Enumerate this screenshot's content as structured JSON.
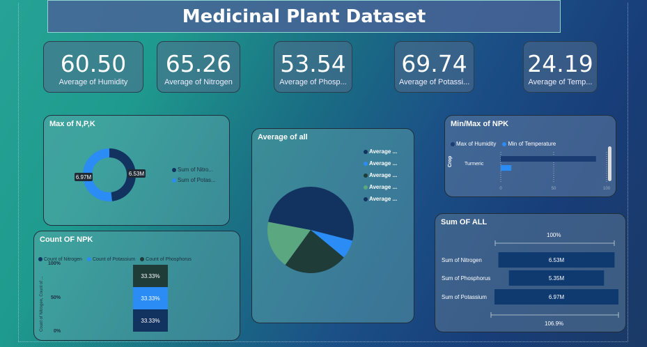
{
  "title": "Medicinal Plant Dataset",
  "kpis": [
    {
      "value": "60.50",
      "label": "Average of Humidity"
    },
    {
      "value": "65.26",
      "label": "Average of Nitrogen"
    },
    {
      "value": "53.54",
      "label": "Average of Phosp..."
    },
    {
      "value": "69.74",
      "label": "Average of Potassi..."
    },
    {
      "value": "24.19",
      "label": "Average of Temp..."
    }
  ],
  "max_npk": {
    "title": "Max of N,P,K",
    "legend": [
      "Sum of Nitro...",
      "Sum of Potas..."
    ],
    "colors": [
      "#12325f",
      "#2b8cf5"
    ]
  },
  "average_all": {
    "title": "Average of all",
    "legend": [
      "Average ...",
      "Average ...",
      "Average ...",
      "Average ...",
      "Average ..."
    ],
    "colors": [
      "#12325f",
      "#2b8cf5",
      "#1f3c38",
      "#5ba77f",
      "#12325f"
    ]
  },
  "minmax_npk": {
    "title": "Min/Max of NPK",
    "legend": [
      "Max of Humidity",
      "Min of Temperature"
    ],
    "axis_label": "Crop",
    "category": "Turmeric",
    "ticks": [
      "0",
      "50",
      "100"
    ],
    "colors": [
      "#1a3c72",
      "#2b8cf5"
    ]
  },
  "count_npk": {
    "title": "Count OF NPK",
    "legend": [
      "Count of Nitrogen",
      "Count of Potassium",
      "Count of Phosphorus"
    ],
    "ylabel": "Count of Nitrogen, Count of ...",
    "yticks": [
      "100%",
      "50%",
      "0%"
    ],
    "colors": [
      "#12325f",
      "#2b8cf5",
      "#1f3c38"
    ]
  },
  "sum_all": {
    "title": "Sum OF ALL",
    "top_label": "100%",
    "bottom_label": "106.9%",
    "rows": [
      {
        "label": "Sum of Nitrogen",
        "value": "6.53M"
      },
      {
        "label": "Sum of Phosphorus",
        "value": "5.35M"
      },
      {
        "label": "Sum of Potassium",
        "value": "6.97M"
      }
    ]
  },
  "chart_data": [
    {
      "type": "pie",
      "title": "Max of N,P,K",
      "categories": [
        "Sum of Nitro...",
        "Sum of Potas..."
      ],
      "values": [
        6.53,
        6.97
      ],
      "data_labels": [
        "6.53M",
        "6.97M"
      ]
    },
    {
      "type": "pie",
      "title": "Average of all",
      "categories": [
        "Average ...",
        "Average ...",
        "Average ...",
        "Average ...",
        "Average ..."
      ],
      "values": [
        22,
        7,
        24,
        18,
        29
      ]
    },
    {
      "type": "bar",
      "title": "Min/Max of NPK",
      "categories": [
        "Turmeric"
      ],
      "series": [
        {
          "name": "Max of Humidity",
          "values": [
            90
          ]
        },
        {
          "name": "Min of Temperature",
          "values": [
            10
          ]
        }
      ],
      "xlim": [
        0,
        100
      ],
      "ylabel": "Crop"
    },
    {
      "type": "bar",
      "title": "Count OF NPK",
      "stacked": true,
      "series": [
        {
          "name": "Count of Nitrogen",
          "values": [
            33.33
          ]
        },
        {
          "name": "Count of Potassium",
          "values": [
            33.33
          ]
        },
        {
          "name": "Count of Phosphorus",
          "values": [
            33.33
          ]
        }
      ],
      "data_labels": [
        "33.33%",
        "33.33%",
        "33.33%"
      ],
      "ylim": [
        0,
        100
      ]
    },
    {
      "type": "bar",
      "title": "Sum OF ALL",
      "categories": [
        "Sum of Nitrogen",
        "Sum of Phosphorus",
        "Sum of Potassium"
      ],
      "values": [
        6.53,
        5.35,
        6.97
      ],
      "data_labels": [
        "6.53M",
        "5.35M",
        "6.97M"
      ]
    }
  ]
}
